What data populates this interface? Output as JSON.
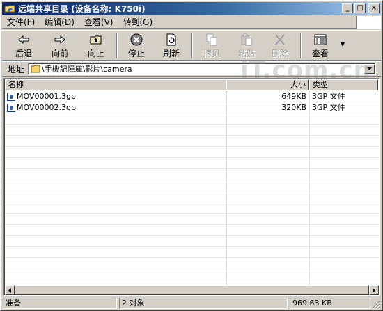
{
  "window": {
    "title": "远端共享目录 (设备名称: K750i)",
    "minimize_label": "_",
    "maximize_label": "□",
    "close_label": "×"
  },
  "menu": {
    "items": [
      {
        "label": "文件(F)"
      },
      {
        "label": "编辑(D)"
      },
      {
        "label": "查看(V)"
      },
      {
        "label": "转到(G)"
      }
    ]
  },
  "toolbar": {
    "back_label": "后退",
    "forward_label": "向前",
    "up_label": "向上",
    "stop_label": "停止",
    "refresh_label": "刷新",
    "copy_label": "拷贝",
    "paste_label": "粘贴",
    "delete_label": "删除",
    "view_label": "查看"
  },
  "address": {
    "label": "地址",
    "path": "\\手機記憶庫\\影片\\camera"
  },
  "list": {
    "columns": {
      "name": "名称",
      "size": "大小",
      "type": "类型"
    },
    "rows": [
      {
        "name": "MOV00001.3gp",
        "size": "649KB",
        "type": "3GP 文件"
      },
      {
        "name": "MOV00002.3gp",
        "size": "320KB",
        "type": "3GP 文件"
      }
    ]
  },
  "status": {
    "state": "准备",
    "count": "2 对象",
    "total_size": "969.63 KB"
  },
  "watermark": "iT.com.cn",
  "colors": {
    "title_bar_start": "#0a246a",
    "title_bar_end": "#a6caf0",
    "face": "#d4d0c8"
  }
}
